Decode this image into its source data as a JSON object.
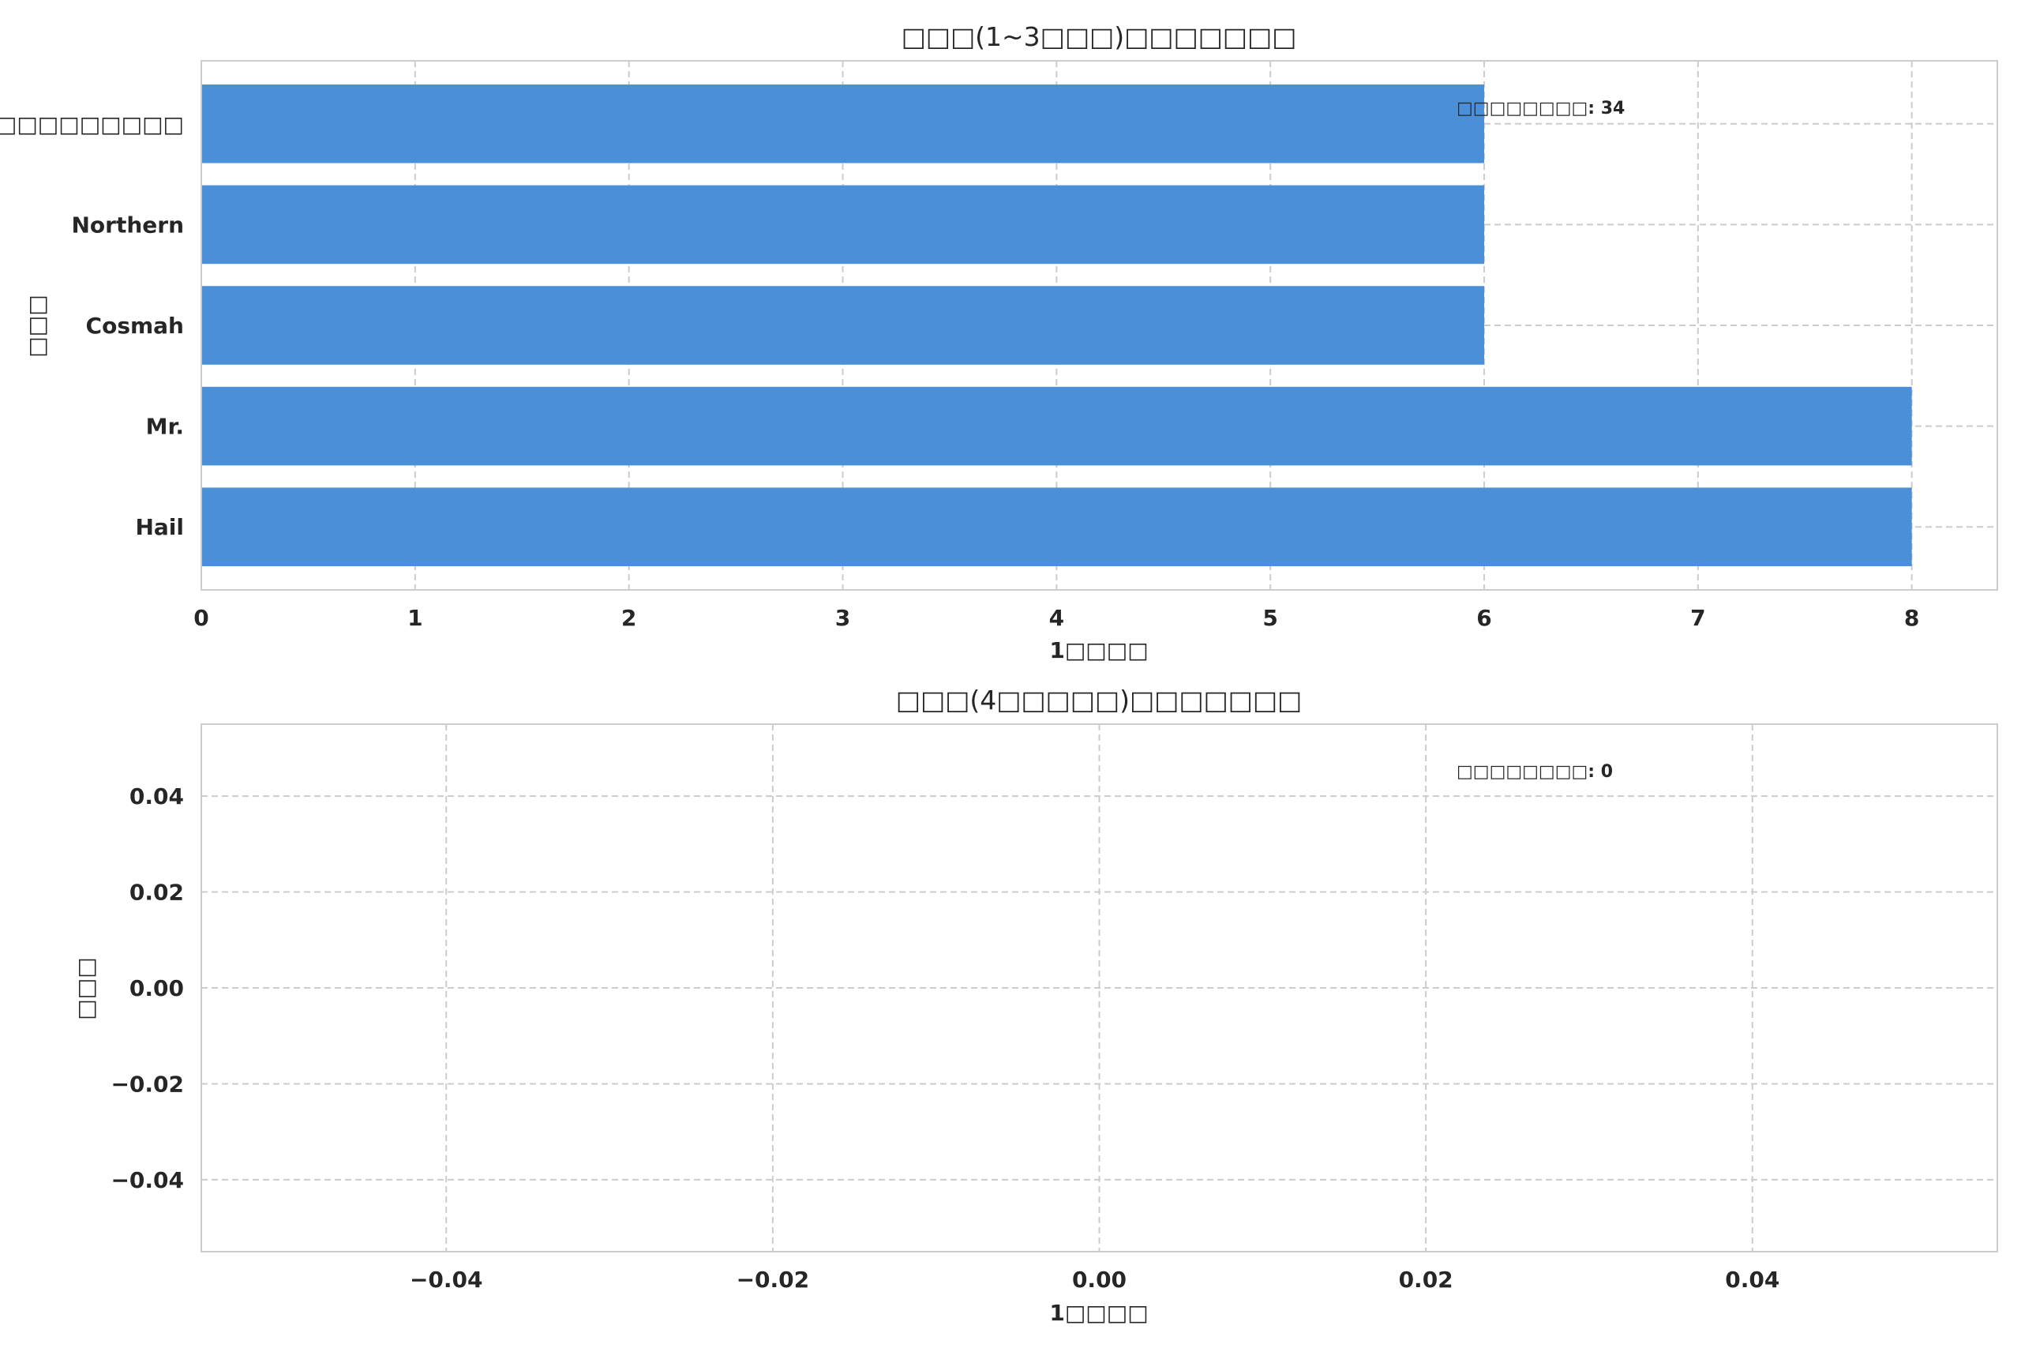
{
  "colors": {
    "bar": "#4a8fd8",
    "grid": "#cccccc",
    "axis": "#cccccc",
    "text": "#262626",
    "background": "#ffffff"
  },
  "chart_data": [
    {
      "type": "bar",
      "orientation": "horizontal",
      "title": "□□□(1~3□□□)□□□□□□□",
      "xlabel": "1□□□□",
      "ylabel": "□□□",
      "categories": [
        "Hail",
        "Mr.",
        "Cosmah",
        "Northern",
        "□□□□□□□□□"
      ],
      "values": [
        8,
        8,
        6,
        6,
        6
      ],
      "xlim": [
        0,
        8.4
      ],
      "xticks": [
        0,
        1,
        2,
        3,
        4,
        5,
        6,
        7,
        8
      ],
      "xtick_labels": [
        "0",
        "1",
        "2",
        "3",
        "4",
        "5",
        "6",
        "7",
        "8"
      ],
      "annotation": "□□□□□□□□: 34",
      "grid": true
    },
    {
      "type": "bar",
      "orientation": "horizontal",
      "title": "□□□(4□□□□□)□□□□□□□",
      "xlabel": "1□□□□",
      "ylabel": "□□□",
      "categories": [],
      "values": [],
      "xlim": [
        -0.055,
        0.055
      ],
      "ylim": [
        -0.055,
        0.055
      ],
      "xticks": [
        -0.04,
        -0.02,
        0.0,
        0.02,
        0.04
      ],
      "xtick_labels": [
        "−0.04",
        "−0.02",
        "0.00",
        "0.02",
        "0.04"
      ],
      "yticks": [
        0.04,
        0.02,
        0.0,
        -0.02,
        -0.04
      ],
      "ytick_labels": [
        "0.04",
        "0.02",
        "0.00",
        "−0.02",
        "−0.04"
      ],
      "annotation": "□□□□□□□□: 0",
      "grid": true
    }
  ]
}
